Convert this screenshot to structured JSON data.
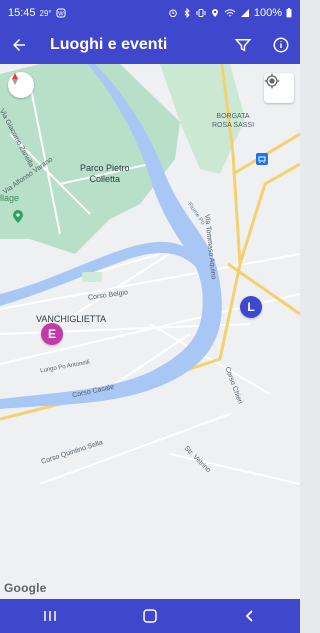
{
  "status": {
    "time": "15:45",
    "temp": "29°",
    "battery": "100%"
  },
  "appbar": {
    "title": "Luoghi e eventi"
  },
  "map": {
    "labels": {
      "park": "Parco Pietro\nColletta",
      "vanchiglietta": "VANCHIGLIETTA",
      "borgata": "BORGATA\nROSA SASSI",
      "corso_belgio": "Corso Belgio",
      "via_aquino": "Via Tommaso Aquino",
      "fiume_po": "Fiume Po",
      "via_zanella": "Via Giacomo Zanella",
      "via_varano": "Via Alfonso Varano",
      "lungo_po": "Lungo Po Antonelli",
      "corso_casale": "Corso Casale",
      "corso_quintino": "Corso Quintino Sella",
      "corso_chieri": "Corso Chieri",
      "strada_vetrino": "Str. Vetrino",
      "village": "llage"
    },
    "markers": {
      "e": "E",
      "l": "L"
    },
    "google": "Google",
    "colors": {
      "primary": "#3f48cc",
      "marker_e": "#c33aa6",
      "marker_l": "#3f48cc",
      "water": "#a9c7f5",
      "park": "#b8dfc7",
      "road_yellow": "#f4d06f"
    }
  },
  "nav": {
    "icons": [
      "recent-apps-icon",
      "home-icon",
      "back-icon"
    ]
  }
}
